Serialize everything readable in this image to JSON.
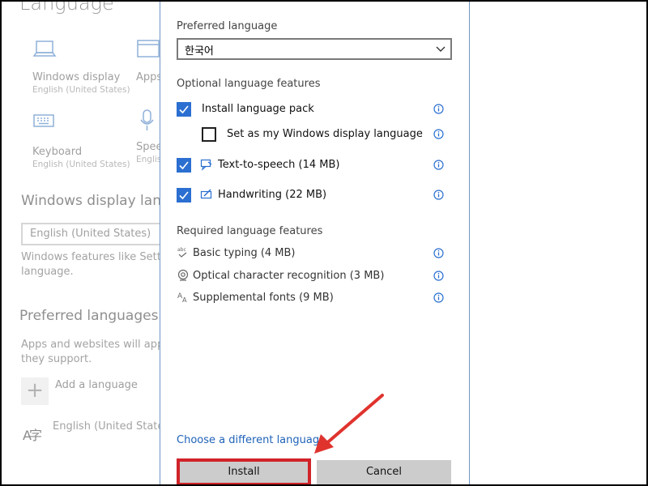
{
  "background": {
    "title": "Language",
    "tiles": [
      {
        "name": "Windows display",
        "sub": "English (United States)",
        "icon": "laptop-icon"
      },
      {
        "name": "Apps",
        "sub": "",
        "icon": "apps-window-icon"
      },
      {
        "name": "Keyboard",
        "sub": "English (United States)",
        "icon": "keyboard-icon"
      },
      {
        "name": "Spee",
        "sub": "Englis",
        "icon": "microphone-icon"
      }
    ],
    "display_heading": "Windows display langu",
    "display_select": "English (United States)",
    "display_note_line1": "Windows features like Settings",
    "display_note_line2": "language.",
    "preferred_heading": "Preferred languages",
    "preferred_note_line1": "Apps and websites will appear",
    "preferred_note_line2": "they support.",
    "add_label": "Add a language",
    "add_symbol": "+",
    "installed_language": "English (United States)",
    "language_glyph": "A字"
  },
  "dialog": {
    "preferred_label": "Preferred language",
    "preferred_value": "한국어",
    "optional_label": "Optional language features",
    "optional": [
      {
        "label": "Install language pack",
        "checked": true,
        "indent": false,
        "icon": ""
      },
      {
        "label": "Set as my Windows display language",
        "checked": false,
        "indent": true,
        "icon": ""
      },
      {
        "label": "Text-to-speech (14 MB)",
        "checked": true,
        "indent": false,
        "icon": "text-to-speech-icon"
      },
      {
        "label": "Handwriting (22 MB)",
        "checked": true,
        "indent": false,
        "icon": "handwriting-icon"
      }
    ],
    "required_label": "Required language features",
    "required": [
      {
        "label": "Basic typing (4 MB)",
        "icon": "basic-typing-icon"
      },
      {
        "label": "Optical character recognition (3 MB)",
        "icon": "ocr-icon"
      },
      {
        "label": "Supplemental fonts (9 MB)",
        "icon": "fonts-icon"
      }
    ],
    "link": "Choose a different language",
    "install_label": "Install",
    "cancel_label": "Cancel"
  },
  "colors": {
    "accent": "#2b6fd1",
    "link": "#1e62b8",
    "highlight": "#d1232a",
    "button": "#cccccc"
  }
}
